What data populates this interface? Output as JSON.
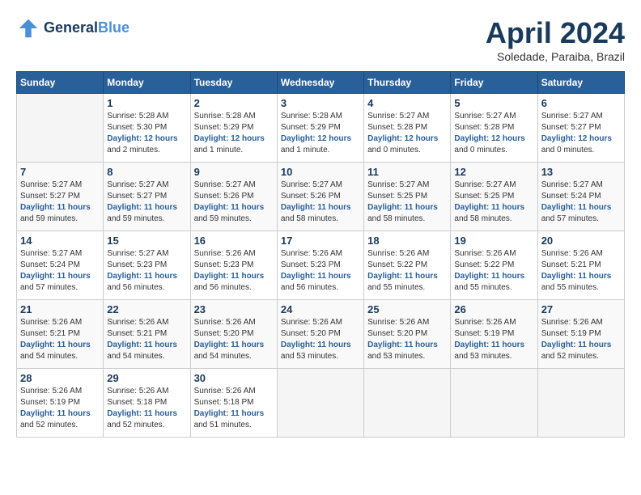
{
  "header": {
    "logo_line1": "General",
    "logo_line2": "Blue",
    "month_title": "April 2024",
    "subtitle": "Soledade, Paraiba, Brazil"
  },
  "days_of_week": [
    "Sunday",
    "Monday",
    "Tuesday",
    "Wednesday",
    "Thursday",
    "Friday",
    "Saturday"
  ],
  "weeks": [
    [
      {
        "day": "",
        "info": ""
      },
      {
        "day": "1",
        "info": "Sunrise: 5:28 AM\nSunset: 5:30 PM\nDaylight: 12 hours\nand 2 minutes."
      },
      {
        "day": "2",
        "info": "Sunrise: 5:28 AM\nSunset: 5:29 PM\nDaylight: 12 hours\nand 1 minute."
      },
      {
        "day": "3",
        "info": "Sunrise: 5:28 AM\nSunset: 5:29 PM\nDaylight: 12 hours\nand 1 minute."
      },
      {
        "day": "4",
        "info": "Sunrise: 5:27 AM\nSunset: 5:28 PM\nDaylight: 12 hours\nand 0 minutes."
      },
      {
        "day": "5",
        "info": "Sunrise: 5:27 AM\nSunset: 5:28 PM\nDaylight: 12 hours\nand 0 minutes."
      },
      {
        "day": "6",
        "info": "Sunrise: 5:27 AM\nSunset: 5:27 PM\nDaylight: 12 hours\nand 0 minutes."
      }
    ],
    [
      {
        "day": "7",
        "info": "Sunrise: 5:27 AM\nSunset: 5:27 PM\nDaylight: 11 hours\nand 59 minutes."
      },
      {
        "day": "8",
        "info": "Sunrise: 5:27 AM\nSunset: 5:27 PM\nDaylight: 11 hours\nand 59 minutes."
      },
      {
        "day": "9",
        "info": "Sunrise: 5:27 AM\nSunset: 5:26 PM\nDaylight: 11 hours\nand 59 minutes."
      },
      {
        "day": "10",
        "info": "Sunrise: 5:27 AM\nSunset: 5:26 PM\nDaylight: 11 hours\nand 58 minutes."
      },
      {
        "day": "11",
        "info": "Sunrise: 5:27 AM\nSunset: 5:25 PM\nDaylight: 11 hours\nand 58 minutes."
      },
      {
        "day": "12",
        "info": "Sunrise: 5:27 AM\nSunset: 5:25 PM\nDaylight: 11 hours\nand 58 minutes."
      },
      {
        "day": "13",
        "info": "Sunrise: 5:27 AM\nSunset: 5:24 PM\nDaylight: 11 hours\nand 57 minutes."
      }
    ],
    [
      {
        "day": "14",
        "info": "Sunrise: 5:27 AM\nSunset: 5:24 PM\nDaylight: 11 hours\nand 57 minutes."
      },
      {
        "day": "15",
        "info": "Sunrise: 5:27 AM\nSunset: 5:23 PM\nDaylight: 11 hours\nand 56 minutes."
      },
      {
        "day": "16",
        "info": "Sunrise: 5:26 AM\nSunset: 5:23 PM\nDaylight: 11 hours\nand 56 minutes."
      },
      {
        "day": "17",
        "info": "Sunrise: 5:26 AM\nSunset: 5:23 PM\nDaylight: 11 hours\nand 56 minutes."
      },
      {
        "day": "18",
        "info": "Sunrise: 5:26 AM\nSunset: 5:22 PM\nDaylight: 11 hours\nand 55 minutes."
      },
      {
        "day": "19",
        "info": "Sunrise: 5:26 AM\nSunset: 5:22 PM\nDaylight: 11 hours\nand 55 minutes."
      },
      {
        "day": "20",
        "info": "Sunrise: 5:26 AM\nSunset: 5:21 PM\nDaylight: 11 hours\nand 55 minutes."
      }
    ],
    [
      {
        "day": "21",
        "info": "Sunrise: 5:26 AM\nSunset: 5:21 PM\nDaylight: 11 hours\nand 54 minutes."
      },
      {
        "day": "22",
        "info": "Sunrise: 5:26 AM\nSunset: 5:21 PM\nDaylight: 11 hours\nand 54 minutes."
      },
      {
        "day": "23",
        "info": "Sunrise: 5:26 AM\nSunset: 5:20 PM\nDaylight: 11 hours\nand 54 minutes."
      },
      {
        "day": "24",
        "info": "Sunrise: 5:26 AM\nSunset: 5:20 PM\nDaylight: 11 hours\nand 53 minutes."
      },
      {
        "day": "25",
        "info": "Sunrise: 5:26 AM\nSunset: 5:20 PM\nDaylight: 11 hours\nand 53 minutes."
      },
      {
        "day": "26",
        "info": "Sunrise: 5:26 AM\nSunset: 5:19 PM\nDaylight: 11 hours\nand 53 minutes."
      },
      {
        "day": "27",
        "info": "Sunrise: 5:26 AM\nSunset: 5:19 PM\nDaylight: 11 hours\nand 52 minutes."
      }
    ],
    [
      {
        "day": "28",
        "info": "Sunrise: 5:26 AM\nSunset: 5:19 PM\nDaylight: 11 hours\nand 52 minutes."
      },
      {
        "day": "29",
        "info": "Sunrise: 5:26 AM\nSunset: 5:18 PM\nDaylight: 11 hours\nand 52 minutes."
      },
      {
        "day": "30",
        "info": "Sunrise: 5:26 AM\nSunset: 5:18 PM\nDaylight: 11 hours\nand 51 minutes."
      },
      {
        "day": "",
        "info": ""
      },
      {
        "day": "",
        "info": ""
      },
      {
        "day": "",
        "info": ""
      },
      {
        "day": "",
        "info": ""
      }
    ]
  ]
}
